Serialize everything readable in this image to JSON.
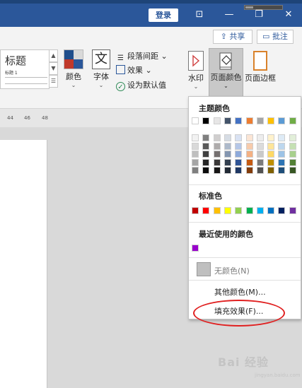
{
  "titlebar": {
    "login_label": "登录",
    "restore_icon": "⊡",
    "minimize_icon": "—",
    "maximize_icon": "❐",
    "close_icon": "✕",
    "progress_fraction": 0.2
  },
  "ribbon": {
    "share_label": "共享",
    "comment_label": "批注",
    "style_title": "标题",
    "style_subtitle": "标题 1",
    "colors_label": "颜色",
    "fonts_label": "字体",
    "paragraph_spacing_label": "段落间距",
    "effects_label": "效果",
    "set_default_label": "设为默认值",
    "watermark_label": "水印",
    "page_color_label": "页面颜色",
    "page_borders_label": "页面边框",
    "colors_icon_swatches": [
      "#1f4e8c",
      "#d9d9d9",
      "#c0392b",
      "#2b579a"
    ]
  },
  "ruler": {
    "ticks": [
      "44",
      "46",
      "48"
    ]
  },
  "page_color_menu": {
    "theme_colors_heading": "主题颜色",
    "theme_row": [
      "#ffffff",
      "#000000",
      "#e7e6e6",
      "#44546a",
      "#4472c4",
      "#ed7d31",
      "#a5a5a5",
      "#ffc000",
      "#5b9bd5",
      "#70ad47"
    ],
    "theme_shades": [
      [
        "#f2f2f2",
        "#7f7f7f",
        "#d0cece",
        "#d6dce4",
        "#d9e2f3",
        "#fbe5d5",
        "#ededed",
        "#fff2cc",
        "#deebf6",
        "#e2efd9"
      ],
      [
        "#d9d9d9",
        "#595959",
        "#aeabab",
        "#adb9ca",
        "#b4c6e7",
        "#f7cbac",
        "#dbdbdb",
        "#fee599",
        "#bdd7ee",
        "#c5e0b3"
      ],
      [
        "#bfbfbf",
        "#3f3f3f",
        "#757070",
        "#8496b0",
        "#8eaadb",
        "#f4b183",
        "#c9c9c9",
        "#ffd965",
        "#9dc3e6",
        "#a8d08d"
      ],
      [
        "#a5a5a5",
        "#262626",
        "#3a3838",
        "#323f4f",
        "#2f5496",
        "#c55a11",
        "#7b7b7b",
        "#bf8f00",
        "#2e75b5",
        "#538135"
      ],
      [
        "#7f7f7f",
        "#0c0c0c",
        "#171616",
        "#222a35",
        "#1f3864",
        "#833c0b",
        "#525252",
        "#7f6000",
        "#1e4e79",
        "#375623"
      ]
    ],
    "standard_colors_heading": "标准色",
    "standard_colors": [
      "#c00000",
      "#ff0000",
      "#ffc000",
      "#ffff00",
      "#92d050",
      "#00b050",
      "#00b0f0",
      "#0070c0",
      "#002060",
      "#7030a0"
    ],
    "recent_colors_heading": "最近使用的颜色",
    "recent_colors": [
      "#9900cc"
    ],
    "no_color_label": "无颜色(N)",
    "more_colors_label": "其他颜色(M)...",
    "fill_effects_label": "填充效果(F)..."
  },
  "watermark": {
    "brand": "Bai 经验",
    "sub": "jingyan.baidu.com"
  }
}
